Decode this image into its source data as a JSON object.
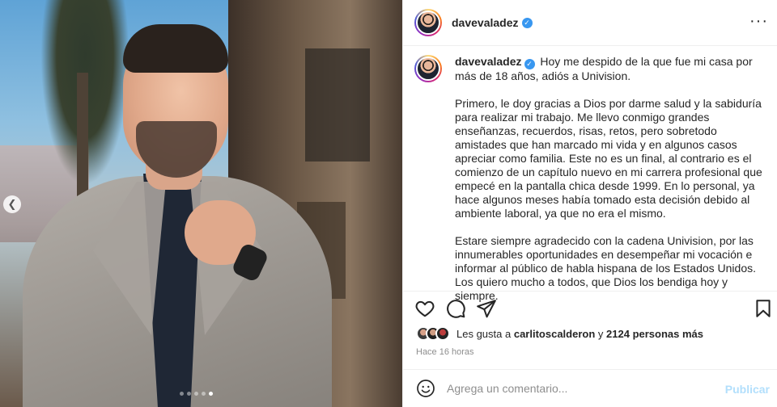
{
  "post": {
    "username": "davevaladez",
    "caption_paragraphs": [
      "Hoy me despido de la que fue mi casa por más de 18 años, adiós a Univision.",
      "Primero, le doy gracias a Dios por darme salud y la sabiduría para realizar mi trabajo. Me llevo conmigo grandes enseñanzas, recuerdos, risas, retos, pero sobretodo amistades que han marcado mi vida y en algunos casos apreciar como familia. Este no es un final, al contrario es el comienzo de un capítulo nuevo en mi carrera profesional que empecé en la pantalla chica desde 1999. En lo personal, ya hace algunos meses había tomado esta decisión debido al ambiente laboral, ya que no era el mismo.",
      "Estare siempre agradecido con la cadena Univision, por las innumerables oportunidades en desempeñar mi vocación e informar al público de habla hispana de los Estados Unidos. Los quiero mucho a todos, que Dios los bendiga hoy y siempre."
    ],
    "likes_prefix": "Les gusta a",
    "likes_user": "carlitoscalderon",
    "likes_connector": "y",
    "likes_others": "2124 personas más",
    "timestamp": "Hace 16 horas"
  },
  "comment": {
    "placeholder": "Agrega un comentario...",
    "publish_label": "Publicar"
  },
  "icons": {
    "more": "more-options-icon",
    "like": "heart-icon",
    "comment": "comment-icon",
    "share": "share-icon",
    "save": "bookmark-icon",
    "emoji": "emoji-icon",
    "carousel_prev": "chevron-left-icon"
  },
  "carousel": {
    "count": 5,
    "active_index": 4
  },
  "colors": {
    "verified": "#3897f0",
    "publish": "#b2dffc",
    "muted": "#8e8e8e"
  }
}
